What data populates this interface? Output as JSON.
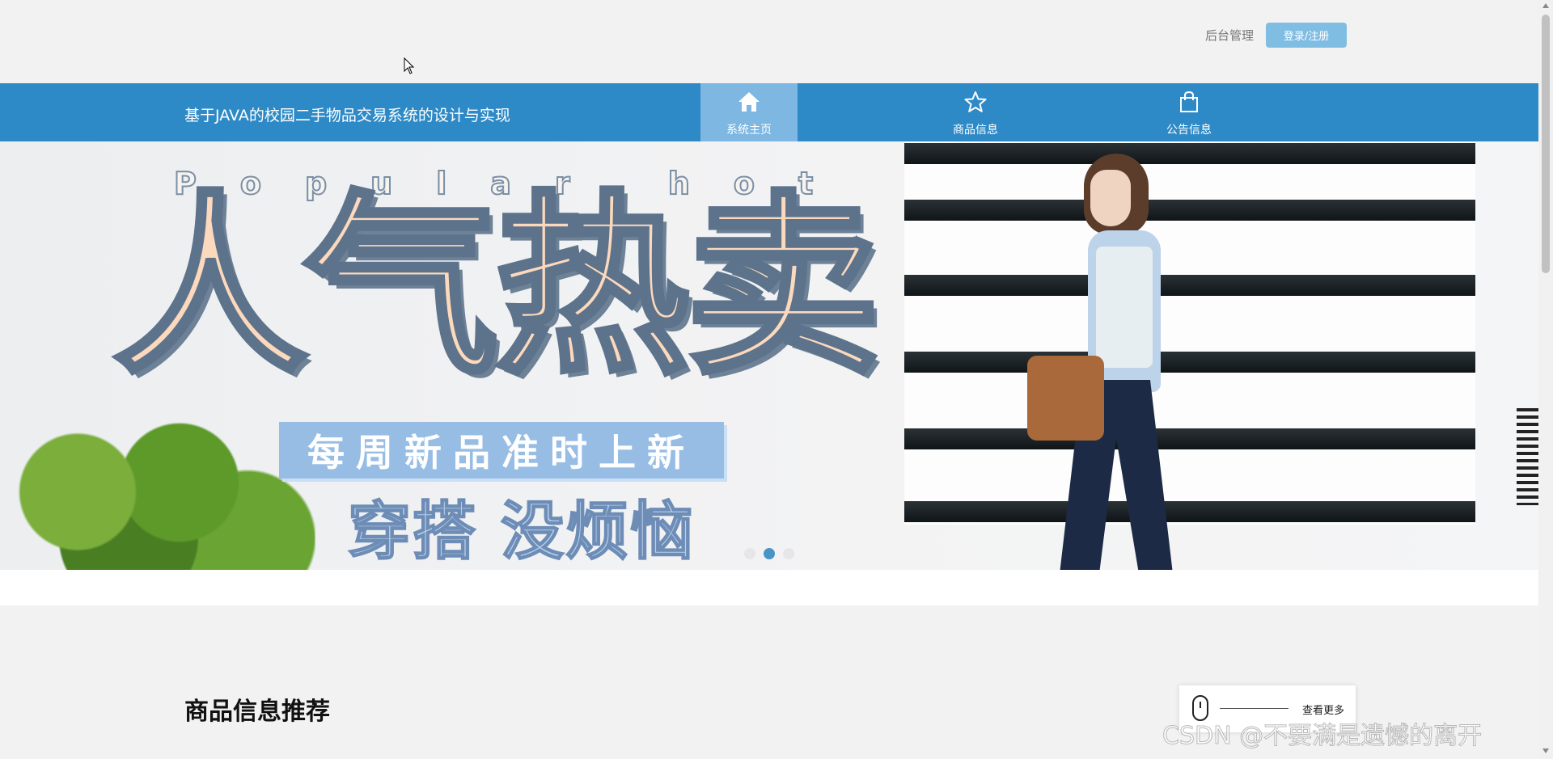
{
  "header": {
    "admin_link": "后台管理",
    "login_button": "登录/注册"
  },
  "navbar": {
    "site_title": "基于JAVA的校园二手物品交易系统的设计与实现",
    "items": [
      {
        "label": "系统主页",
        "icon": "home-icon",
        "active": true
      },
      {
        "label": "商品信息",
        "icon": "star-icon",
        "active": false
      },
      {
        "label": "公告信息",
        "icon": "shopping-bag-icon",
        "active": false
      }
    ],
    "colors": {
      "bar": "#2e8ac6",
      "active": "#7db7e2"
    }
  },
  "banner": {
    "headline_en": "Popular hot",
    "headline_cn": "人气热卖",
    "tag": "每周新品准时上新",
    "slogan": "穿搭 没烦恼",
    "slide_count": 3,
    "active_slide": 2
  },
  "section": {
    "title": "商品信息推荐",
    "more_label": "查看更多"
  },
  "watermark": "CSDN @不要满是遗憾的离开"
}
